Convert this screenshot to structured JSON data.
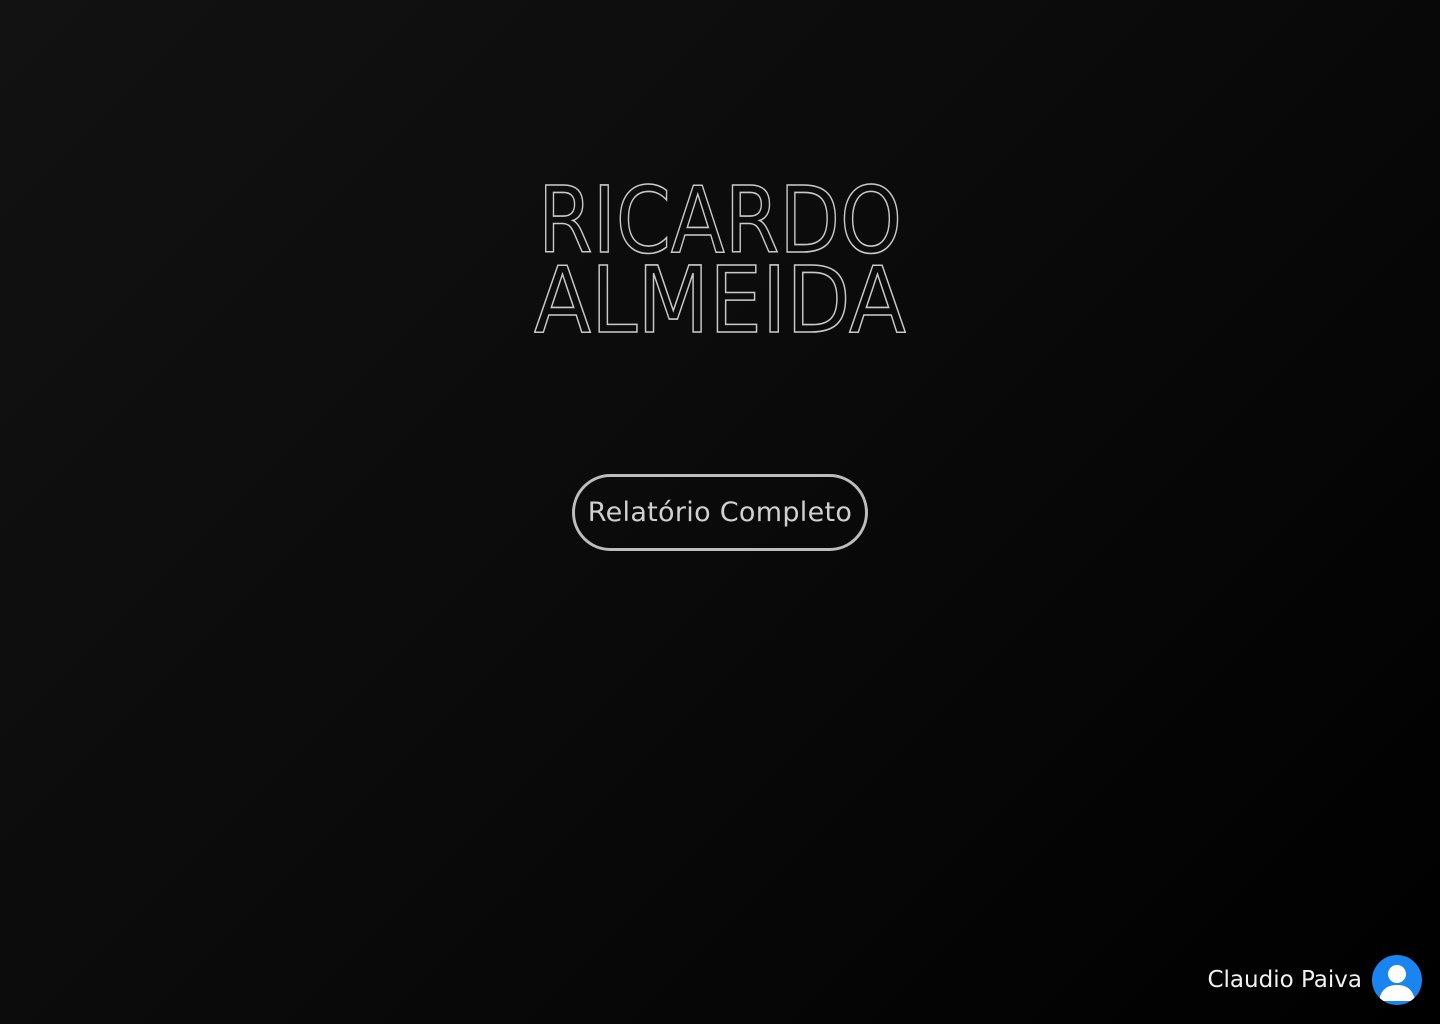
{
  "logo": {
    "line1": "RICARDO",
    "line2": "ALMEIDA"
  },
  "report_button": {
    "label": "Relatório Completo"
  },
  "user": {
    "name": "Claudio Paiva",
    "avatar_icon": "user-avatar-icon",
    "avatar_color": "#1a84f0"
  },
  "colors": {
    "background_start": "#121212",
    "background_end": "#000000",
    "logo_stroke": "#c9c9c9",
    "button_border": "#bdbdbd"
  }
}
